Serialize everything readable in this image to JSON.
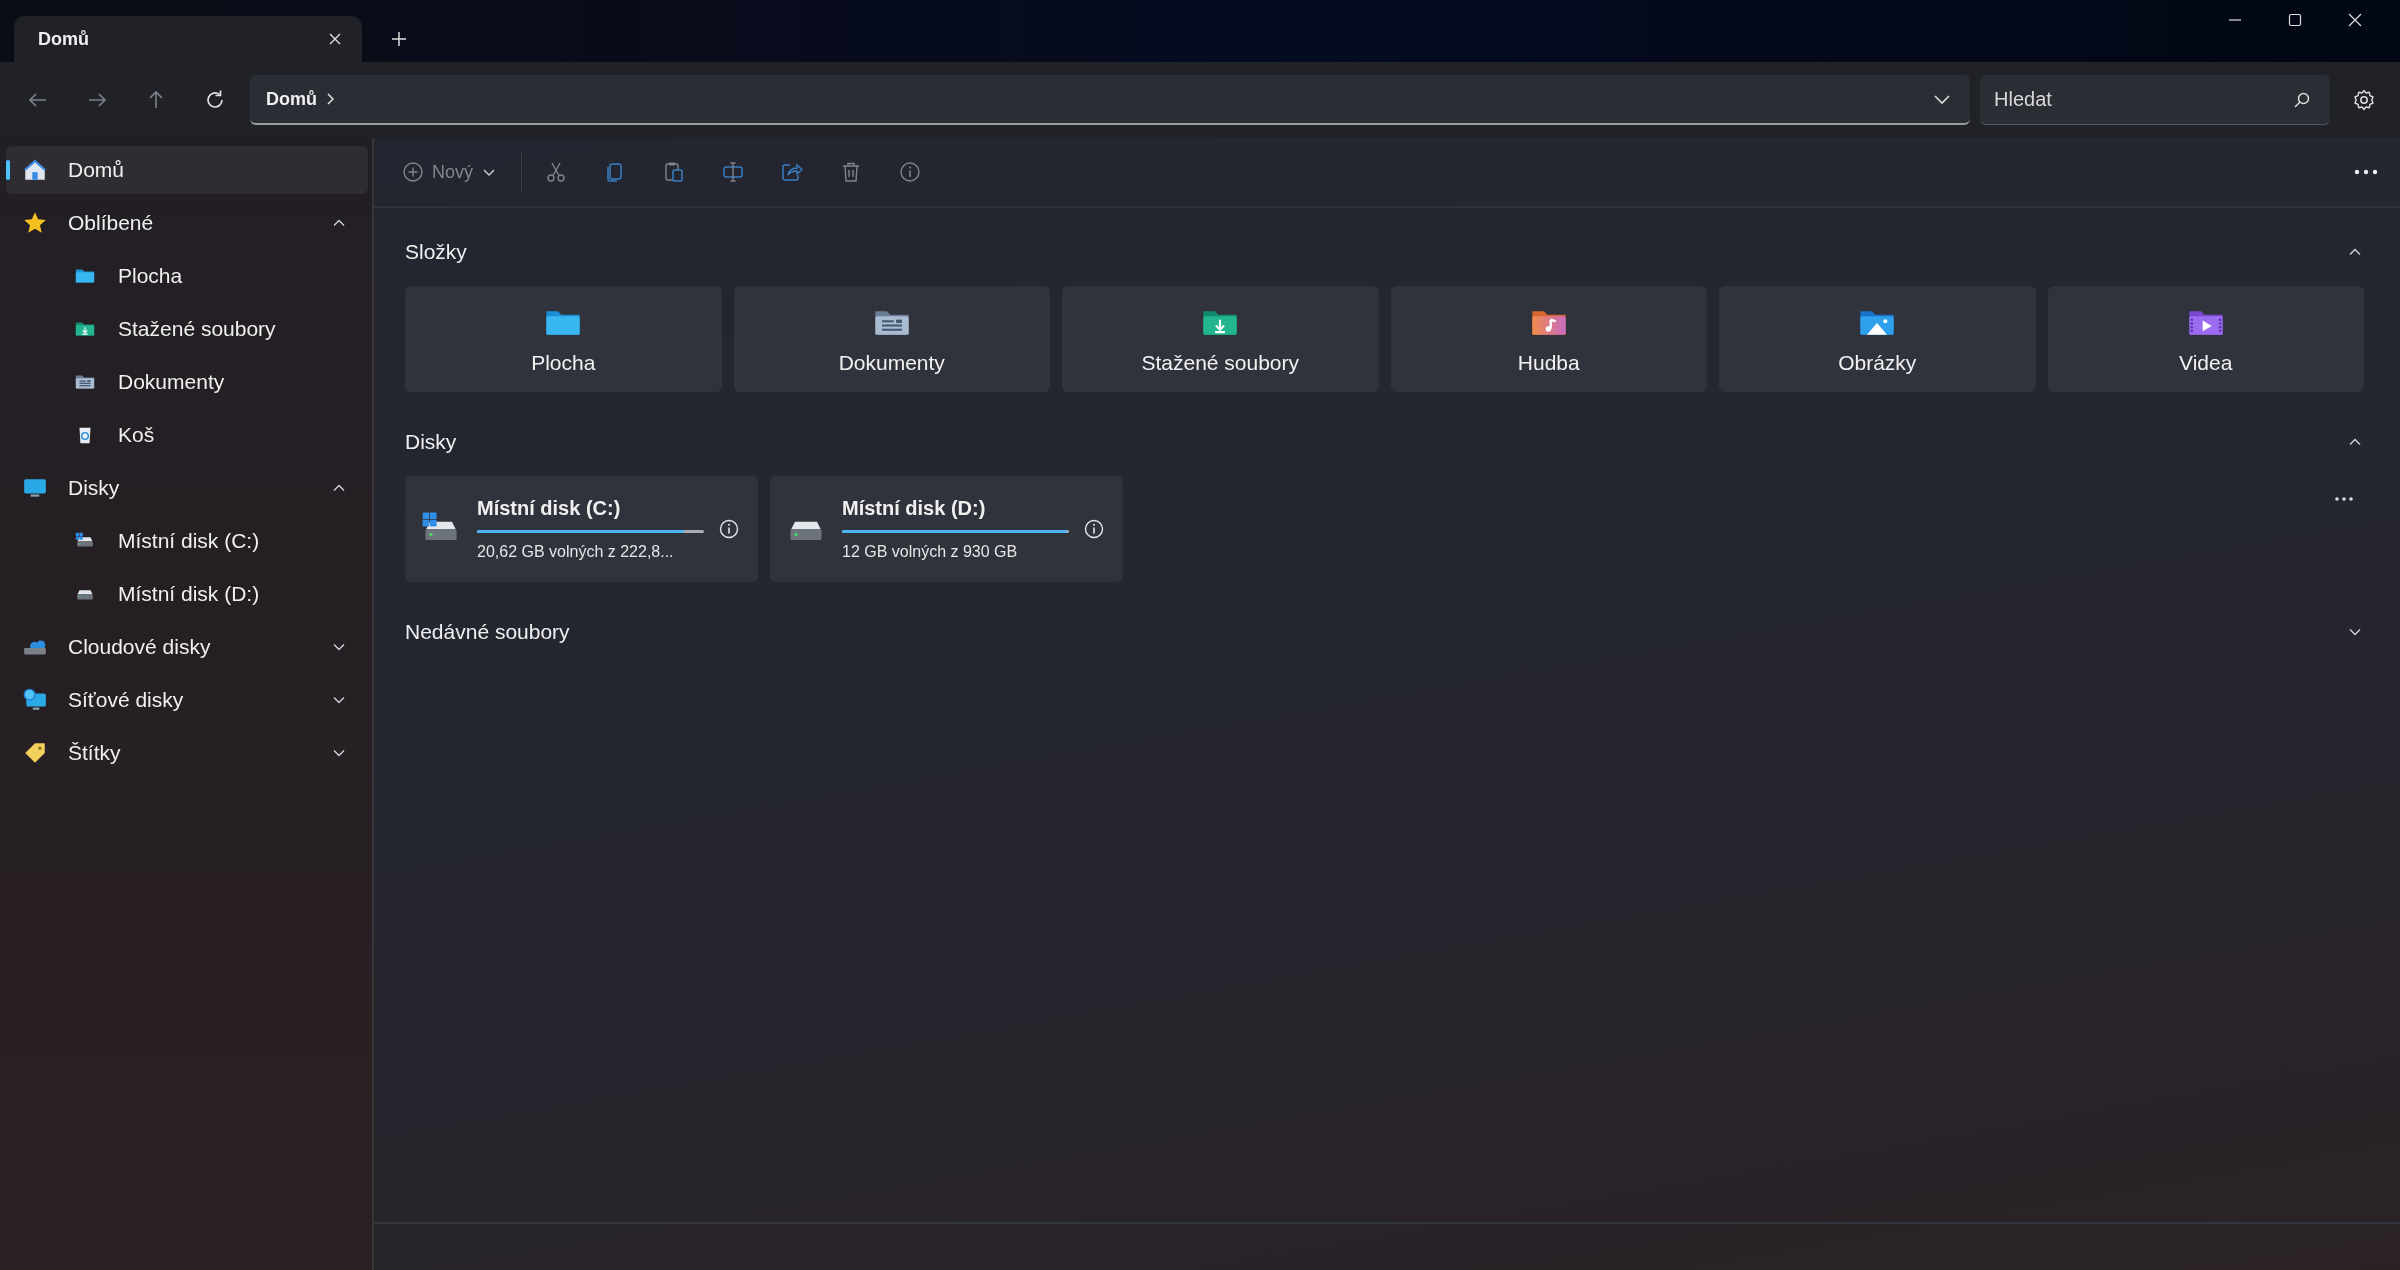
{
  "tabs": [
    {
      "label": "Domů",
      "selected": true
    }
  ],
  "address_bar": {
    "breadcrumb": "Domů"
  },
  "search": {
    "placeholder": "Hledat"
  },
  "sidebar": {
    "items": [
      {
        "kind": "home",
        "label": "Domů",
        "selected": true
      },
      {
        "kind": "favorites",
        "label": "Oblíbené",
        "selected": false,
        "expanded": true,
        "children": [
          {
            "kind": "desktop",
            "label": "Plocha",
            "selected": false
          },
          {
            "kind": "downloads",
            "label": "Stažené soubory",
            "selected": false
          },
          {
            "kind": "documents",
            "label": "Dokumenty",
            "selected": false
          },
          {
            "kind": "recycle",
            "label": "Koš",
            "selected": false
          }
        ]
      },
      {
        "kind": "drives",
        "label": "Disky",
        "selected": false,
        "expanded": true,
        "children": [
          {
            "kind": "drive_system",
            "label": "Místní disk (C:)",
            "selected": false
          },
          {
            "kind": "drive",
            "label": "Místní disk (D:)",
            "selected": false
          }
        ]
      },
      {
        "kind": "cloud",
        "label": "Cloudové disky",
        "selected": false,
        "expanded": false
      },
      {
        "kind": "network",
        "label": "Síťové disky",
        "selected": false,
        "expanded": false
      },
      {
        "kind": "tags",
        "label": "Štítky",
        "selected": false,
        "expanded": false
      }
    ]
  },
  "toolbar": {
    "new_button": "Nový"
  },
  "sections": [
    {
      "kind": "folders",
      "title": "Složky",
      "expanded": true,
      "items": [
        {
          "kind": "desktop",
          "label": "Plocha"
        },
        {
          "kind": "documents",
          "label": "Dokumenty"
        },
        {
          "kind": "downloads",
          "label": "Stažené soubory"
        },
        {
          "kind": "music",
          "label": "Hudba"
        },
        {
          "kind": "pictures",
          "label": "Obrázky"
        },
        {
          "kind": "videos",
          "label": "Videa"
        }
      ]
    },
    {
      "kind": "drives",
      "title": "Disky",
      "expanded": true,
      "items": [
        {
          "kind": "drive_system",
          "name": "Místní disk (C:)",
          "level": 0.91,
          "free": "20,62 GB volných z 222,8..."
        },
        {
          "kind": "drive",
          "name": "Místní disk (D:)",
          "level": 0.99,
          "free": "12 GB volných z 930 GB"
        }
      ]
    },
    {
      "title": "Nedávné soubory",
      "expanded": false
    }
  ]
}
